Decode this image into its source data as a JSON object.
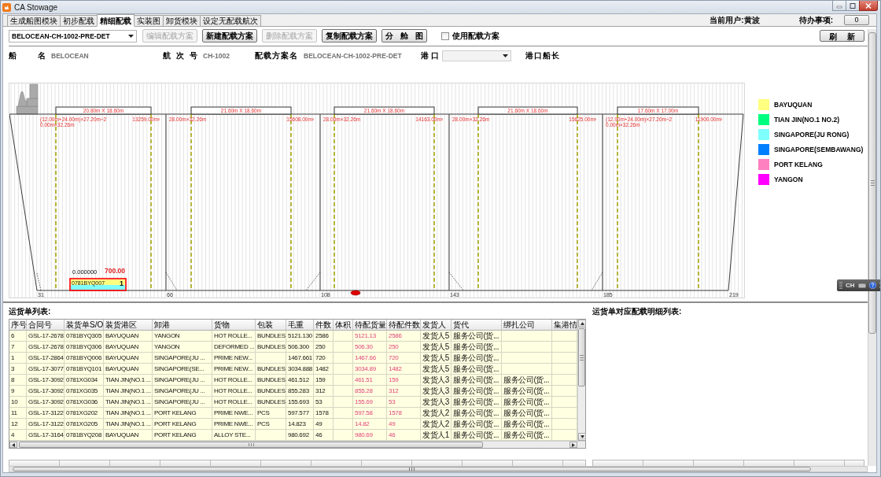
{
  "window": {
    "title": "CA Stowage"
  },
  "tabs": [
    {
      "label": "生成船图模块",
      "selected": false
    },
    {
      "label": "初步配载",
      "selected": false
    },
    {
      "label": "精细配载",
      "selected": true
    },
    {
      "label": "实装图",
      "selected": false
    },
    {
      "label": "卸货模块",
      "selected": false
    },
    {
      "label": "设定无配载航次",
      "selected": false
    }
  ],
  "header": {
    "user": "当前用户:黄波",
    "todo_label": "待办事项:",
    "todo_count": "0"
  },
  "toolbar": {
    "plan_select": "BELOCEAN-CH-1002-PRE-DET",
    "buttons": [
      {
        "label": "编辑配载方案",
        "disabled": true
      },
      {
        "label": "新建配载方案",
        "disabled": false
      },
      {
        "label": "删除配载方案",
        "disabled": true
      },
      {
        "label": "复制配载方案",
        "disabled": false
      },
      {
        "label": "分 舱 图",
        "disabled": false
      }
    ],
    "use_plan": {
      "label": "使用配载方案",
      "checked": false
    },
    "refresh": "刷 新"
  },
  "info": [
    {
      "kind": "text",
      "label": "船 名",
      "value": "BELOCEAN"
    },
    {
      "kind": "text",
      "label": "航 次 号",
      "value": "CH-1002"
    },
    {
      "kind": "text",
      "label": "配载方案名",
      "value": "BELOCEAN-CH-1002-PRE-DET"
    },
    {
      "kind": "select",
      "label": "港 口"
    },
    {
      "kind": "label",
      "label": "港口船长"
    }
  ],
  "ship_plan": {
    "holds": [
      {
        "hatch": "20.80m X 18.60m",
        "formula": [
          "(12.00m+24.00m)×27.20m÷2",
          "0.00m×32.26m"
        ],
        "volume": "13259.00m³"
      },
      {
        "hatch": "21.60m X 18.60m",
        "formula": [
          "28.00m×32.26m"
        ],
        "volume": "15608.00m³"
      },
      {
        "hatch": "21.60m X 18.60m",
        "formula": [
          "28.00m×32.26m"
        ],
        "volume": "14163.00m³"
      },
      {
        "hatch": "21.60m X 18.60m",
        "formula": [
          "28.00m×32.26m"
        ],
        "volume": "15625.00m³"
      },
      {
        "hatch": "17.60m X 17.00m",
        "formula": [
          "(12.90m+24.00m)×27.20m÷2",
          "0.00m×32.26m"
        ],
        "volume": "11900.00m³"
      }
    ],
    "frames": [
      "31",
      "66",
      "108",
      "143",
      "185",
      "219"
    ],
    "cargo": [
      {
        "code": "0781BYQ007",
        "count": "1",
        "value": "0.000000",
        "weight": "700.00",
        "selected": true,
        "bands": [
          {
            "color": "#ffff80"
          },
          {
            "color": "#80ffff"
          }
        ]
      }
    ]
  },
  "legend": [
    {
      "label": "BAYUQUAN",
      "color": "#ffff80"
    },
    {
      "label": "TIAN JIN(NO.1 NO.2)",
      "color": "#00ff80"
    },
    {
      "label": "SINGAPORE(JU RONG)",
      "color": "#80ffff"
    },
    {
      "label": "SINGAPORE(SEMBAWANG)",
      "color": "#0080ff"
    },
    {
      "label": "PORT KELANG",
      "color": "#ff80c0"
    },
    {
      "label": "YANGON",
      "color": "#ff00ff"
    }
  ],
  "waybill_list": {
    "title": "运货单列表:",
    "columns": [
      {
        "label": "序号",
        "kind": "plain"
      },
      {
        "label": "合同号",
        "kind": "plain"
      },
      {
        "label": "装货单S/O",
        "kind": "plain"
      },
      {
        "label": "装货港区",
        "kind": "plain"
      },
      {
        "label": "卸港",
        "kind": "plain"
      },
      {
        "label": "货物",
        "kind": "plain"
      },
      {
        "label": "包装",
        "kind": "plain"
      },
      {
        "label": "毛重",
        "kind": "plain"
      },
      {
        "label": "件数",
        "kind": "plain"
      },
      {
        "label": "体积",
        "kind": "plain"
      },
      {
        "label": "待配货量",
        "kind": "pending"
      },
      {
        "label": "待配件数",
        "kind": "pending"
      },
      {
        "label": "发货人",
        "kind": "plain"
      },
      {
        "label": "货代",
        "kind": "plain"
      },
      {
        "label": "绑扎公司",
        "kind": "plain"
      },
      {
        "label": "集港情",
        "kind": "plain"
      }
    ],
    "rows": [
      [
        "6",
        "GSL-17-2678",
        "0781BYQ305",
        "BAYUQUAN",
        "YANGON",
        "HOT ROLLE...",
        "BUNDLES",
        "5121.130",
        "2586",
        null,
        "5121.13",
        "2586",
        "发货人5",
        "服务公司(货...",
        null,
        null
      ],
      [
        "7",
        "GSL-17-2678",
        "0781BYQ306",
        "BAYUQUAN",
        "YANGON",
        "DEFORMED ...",
        "BUNDLES",
        "506.300",
        "250",
        null,
        "506.30",
        "250",
        "发货人5",
        "服务公司(货...",
        null,
        null
      ],
      [
        "1",
        "GSL-17-2864",
        "0781BYQ006",
        "BAYUQUAN",
        "SINGAPORE(JU ...",
        "PRIME NEW...",
        null,
        "1467.661",
        "720",
        null,
        "1467.66",
        "720",
        "发货人5",
        "服务公司(货...",
        null,
        null
      ],
      [
        "3",
        "GSL-17-3077",
        "0781BYQ101",
        "BAYUQUAN",
        "SINGAPORE(SE...",
        "PRIME NEW...",
        "BUNDLES",
        "3034.888",
        "1482",
        null,
        "3034.89",
        "1482",
        "发货人5",
        "服务公司(货...",
        null,
        null
      ],
      [
        "8",
        "GSL-17-3092",
        "0781XG034",
        "TIAN JIN(NO.1 ...",
        "SINGAPORE(JU ...",
        "HOT ROLLE...",
        "BUNDLES",
        "461.512",
        "159",
        null,
        "461.51",
        "159",
        "发货人3",
        "服务公司(货...",
        "服务公司(货...",
        null
      ],
      [
        "9",
        "GSL-17-3092",
        "0781XG035",
        "TIAN JIN(NO.1 ...",
        "SINGAPORE(JU ...",
        "HOT ROLLE...",
        "BUNDLES",
        "855.283",
        "312",
        null,
        "855.28",
        "312",
        "发货人3",
        "服务公司(货...",
        "服务公司(货...",
        null
      ],
      [
        "10",
        "GSL-17-3092",
        "0781XG036",
        "TIAN JIN(NO.1 ...",
        "SINGAPORE(JU ...",
        "HOT ROLLE...",
        "BUNDLES",
        "155.693",
        "53",
        null,
        "155.69",
        "53",
        "发货人3",
        "服务公司(货...",
        "服务公司(货...",
        null
      ],
      [
        "11",
        "GSL-17-3122",
        "0781XG202",
        "TIAN JIN(NO.1 ...",
        "PORT KELANG",
        "PRIME NWE...",
        "PCS",
        "597.577",
        "1578",
        null,
        "597.58",
        "1578",
        "发货人2",
        "服务公司(货...",
        "服务公司(货...",
        null
      ],
      [
        "12",
        "GSL-17-3122",
        "0781XG205",
        "TIAN JIN(NO.1 ...",
        "PORT KELANG",
        "PRIME NWE...",
        "PCS",
        "14.823",
        "49",
        null,
        "14.82",
        "49",
        "发货人2",
        "服务公司(货...",
        "服务公司(货...",
        null
      ],
      [
        "4",
        "GSL-17-3164",
        "0781BYQ208",
        "BAYUQUAN",
        "PORT KELANG",
        "ALLOY STE...",
        null,
        "980.692",
        "46",
        null,
        "980.69",
        "46",
        "发货人1",
        "服务公司(货...",
        "服务公司(货...",
        null
      ]
    ]
  },
  "detail_list": {
    "title": "运货单对应配载明细列表:"
  },
  "language_bar": {
    "label": "CH"
  }
}
